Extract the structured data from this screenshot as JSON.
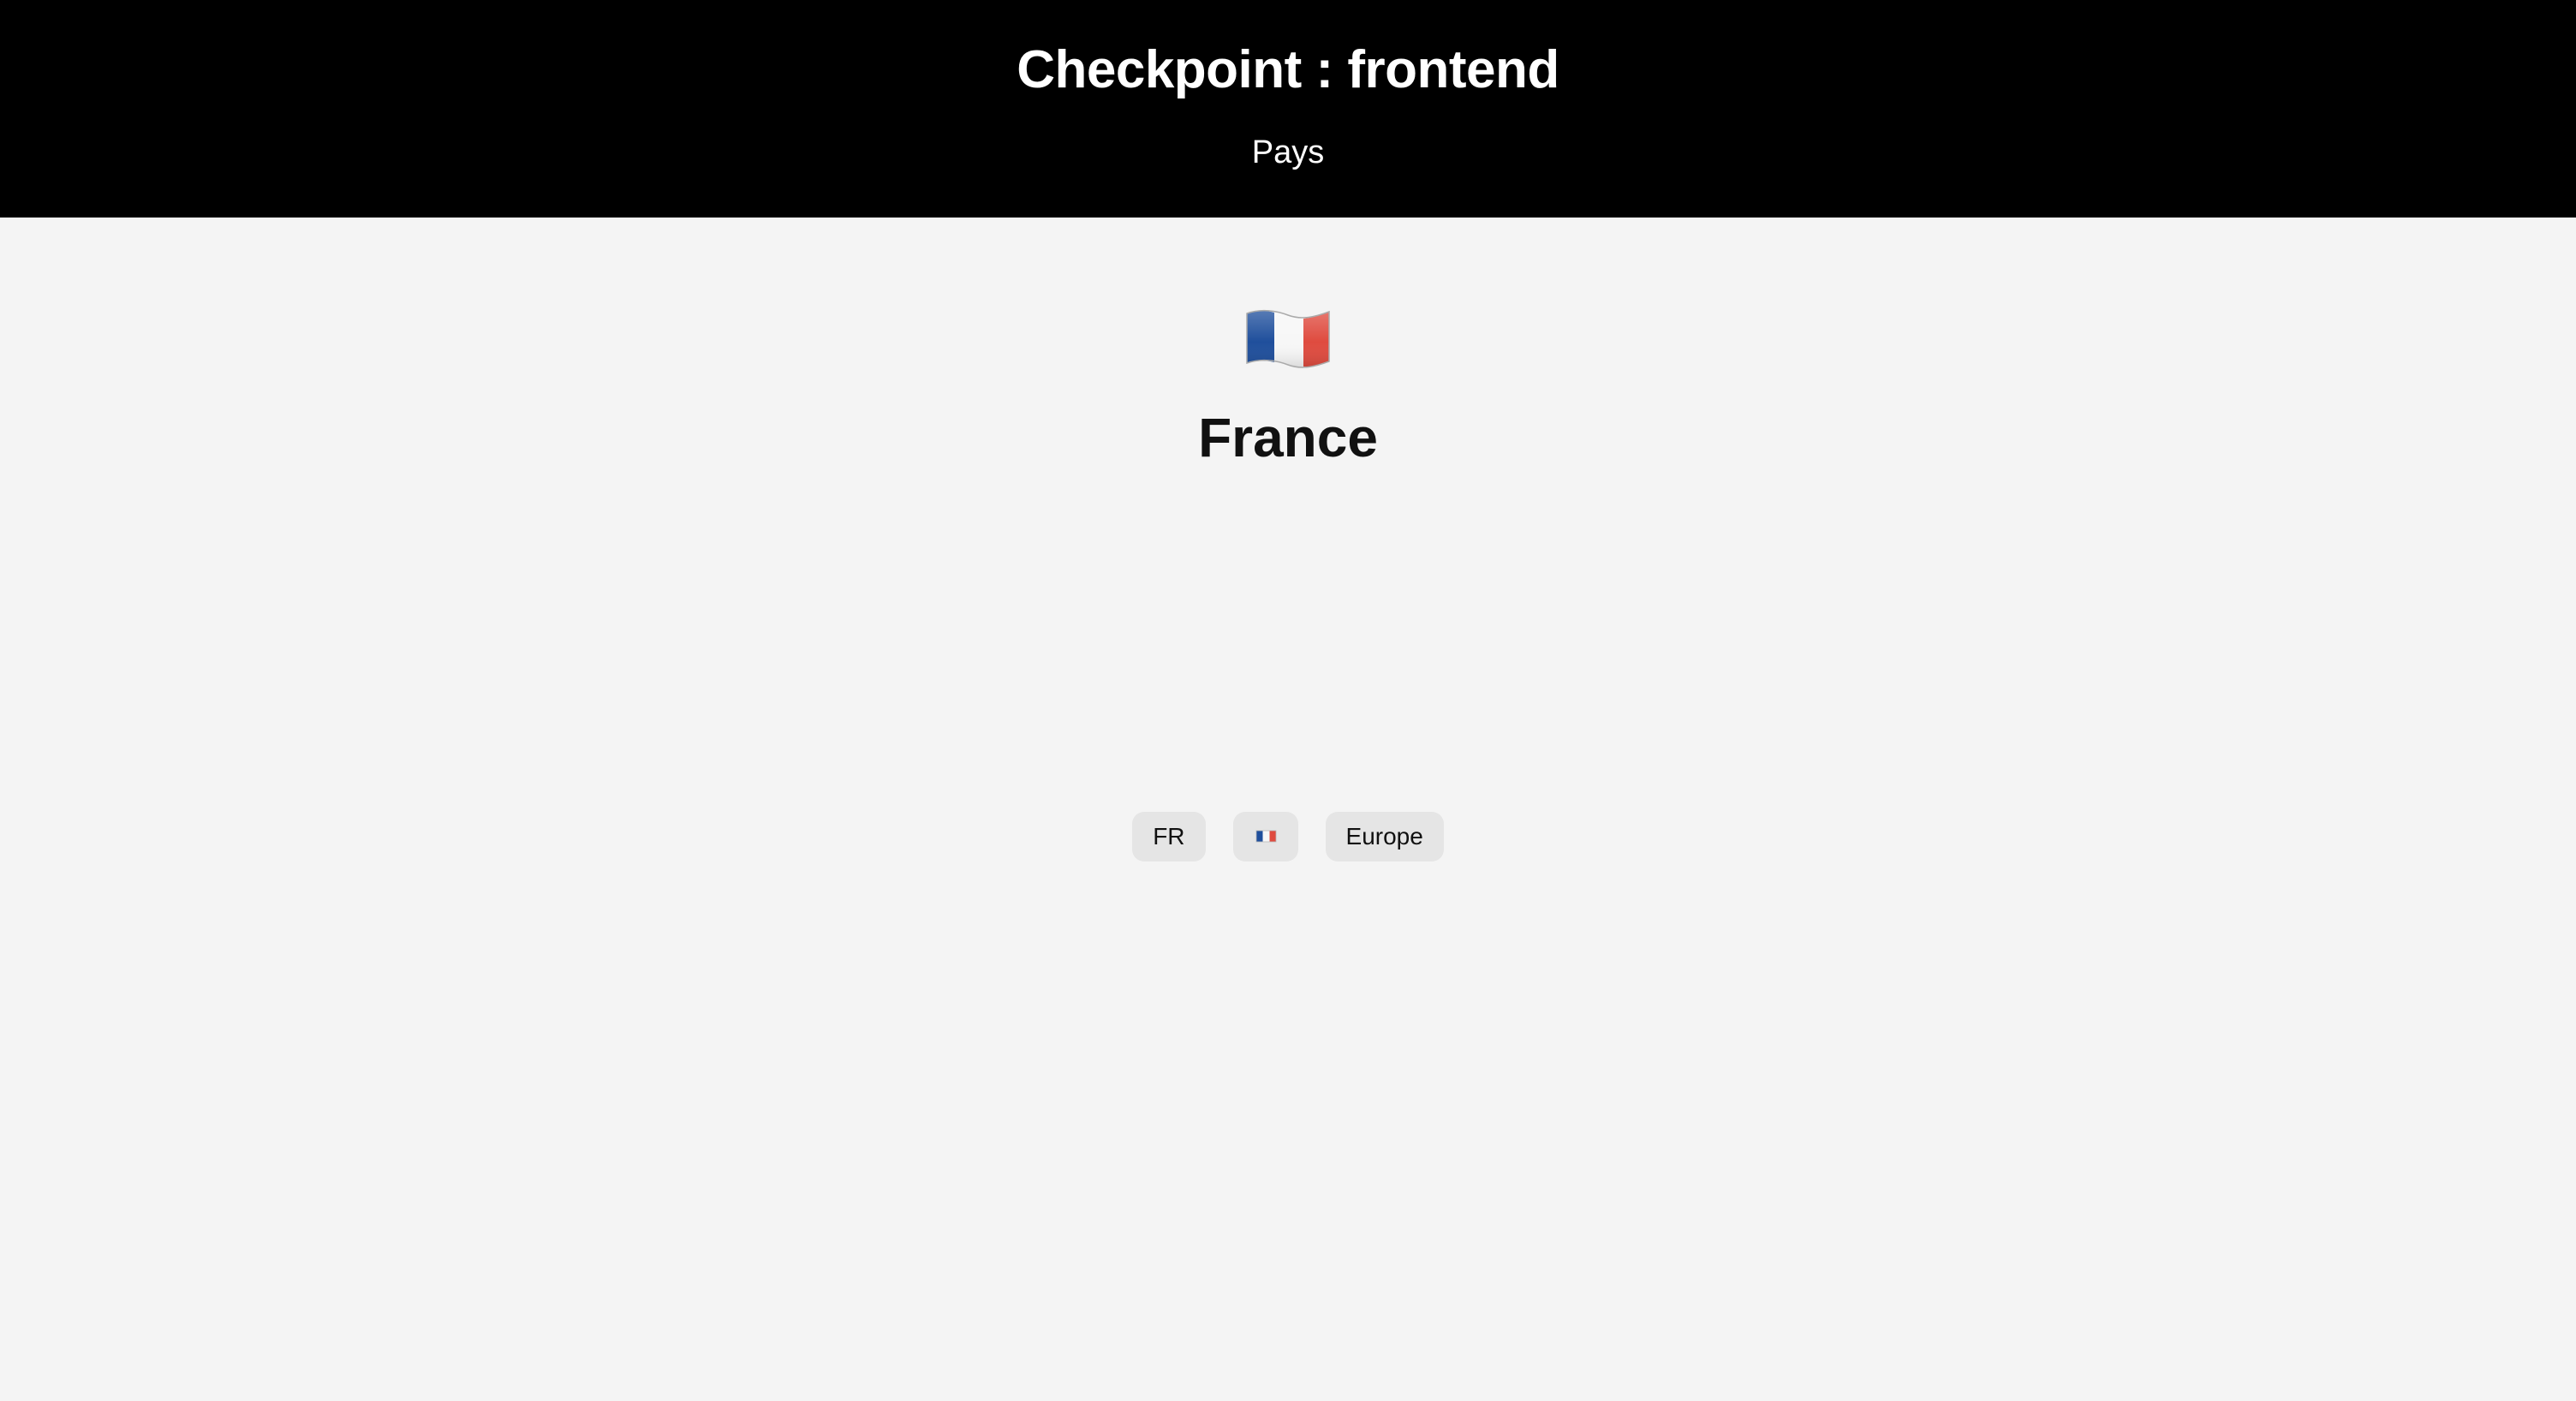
{
  "header": {
    "title": "Checkpoint : frontend",
    "subtitle": "Pays"
  },
  "country": {
    "flag_icon": "france-flag-icon",
    "name": "France",
    "tags": {
      "code": "FR",
      "flag_icon": "france-flag-icon",
      "region": "Europe"
    }
  },
  "colors": {
    "header_background": "#000000",
    "page_background": "#f4f4f4",
    "tag_background": "#e5e5e5",
    "flag_blue": "#1f4f9c",
    "flag_white": "#f7f7f7",
    "flag_red": "#df4b3f"
  }
}
